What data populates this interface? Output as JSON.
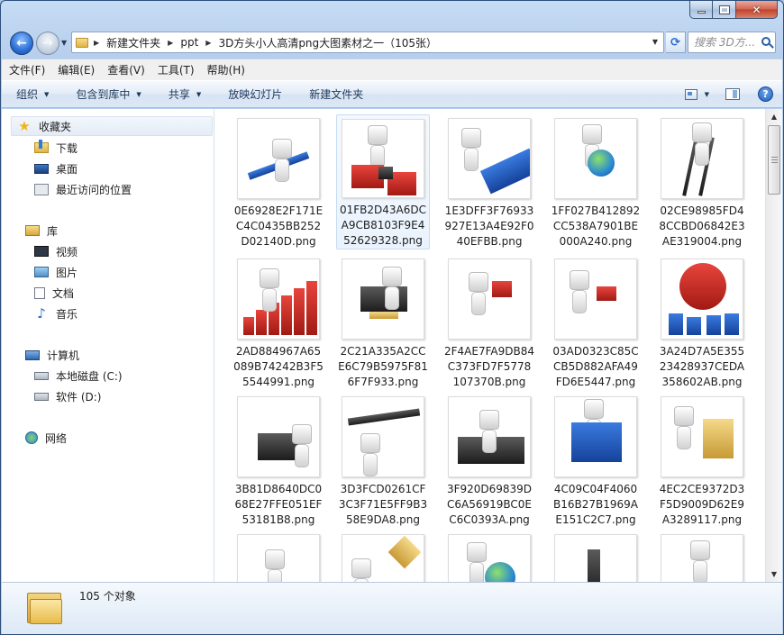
{
  "window": {
    "breadcrumb": [
      "新建文件夹",
      "ppt",
      "3D方头小人高清png大图素材之一（105张）"
    ],
    "search_placeholder": "搜索 3D方..."
  },
  "menubar": {
    "items": [
      "文件(F)",
      "编辑(E)",
      "查看(V)",
      "工具(T)",
      "帮助(H)"
    ]
  },
  "commandbar": {
    "organize": "组织",
    "include_in_library": "包含到库中",
    "share": "共享",
    "slideshow": "放映幻灯片",
    "new_folder": "新建文件夹"
  },
  "navpane": {
    "favorites": "收藏夹",
    "downloads": "下载",
    "desktop": "桌面",
    "recent": "最近访问的位置",
    "libraries": "库",
    "videos": "视频",
    "pictures": "图片",
    "documents": "文档",
    "music": "音乐",
    "computer": "计算机",
    "local_disk": "本地磁盘 (C:)",
    "software_disk": "软件 (D:)",
    "network": "网络"
  },
  "files": [
    {
      "name": "0E6928E2F171EC4C0435BB252D02140D.png",
      "art": "pencil"
    },
    {
      "name": "01FB2D43A6DCA9CB8103F9E452629328.png",
      "art": "boxing",
      "selected": true
    },
    {
      "name": "1E3DFF3F76933927E13A4E92F040EFBB.png",
      "art": "paintroller"
    },
    {
      "name": "1FF027B412892CC538A7901BE000A240.png",
      "art": "globe"
    },
    {
      "name": "02CE98985FD48CCBD06842E3AE319004.png",
      "art": "ladder"
    },
    {
      "name": "2AD884967A65089B74242B3F55544991.png",
      "art": "redbars"
    },
    {
      "name": "2C21A335A2CCE6C79B5975F816F7F933.png",
      "art": "lock"
    },
    {
      "name": "2F4AE7FA9DB84C373FD7F5778107370B.png",
      "art": "megaphone"
    },
    {
      "name": "03AD0323C85CCB5D882AFA49FD6E5447.png",
      "art": "megaphone2"
    },
    {
      "name": "3A24D7A5E35523428937CEDA358602AB.png",
      "art": "clock"
    },
    {
      "name": "3B81D8640DC068E27FFE051EF53181B8.png",
      "art": "laptop"
    },
    {
      "name": "3D3FCD0261CF3C3F71E5FF9B358E9DA8.png",
      "art": "biz"
    },
    {
      "name": "3F920D69839DC6A56919BC0EC6C0393A.png",
      "art": "steering"
    },
    {
      "name": "4C09C04F4060B16B27B1969AE151C2C7.png",
      "art": "board"
    },
    {
      "name": "4EC2CE9372D3F5D9009D62E9A3289117.png",
      "art": "scroll"
    },
    {
      "name": "",
      "art": "cheer"
    },
    {
      "name": "",
      "art": "sign"
    },
    {
      "name": "",
      "art": "globe2"
    },
    {
      "name": "",
      "art": "microscope"
    },
    {
      "name": "",
      "art": "wave"
    }
  ],
  "status": {
    "count": "105 个对象"
  }
}
